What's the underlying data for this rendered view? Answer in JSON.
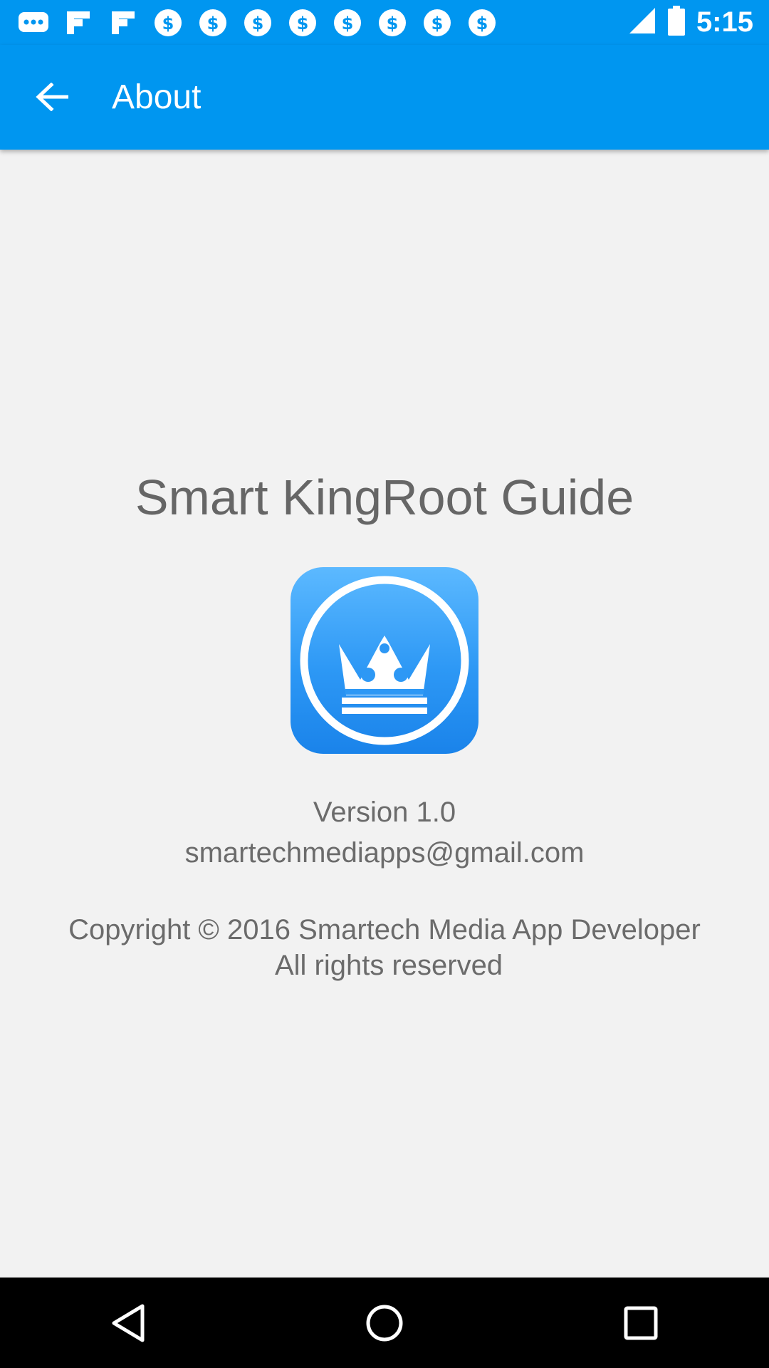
{
  "status_bar": {
    "time": "5:15",
    "icons": [
      "messages-icon",
      "flipboard-icon",
      "flipboard-icon",
      "money-icon",
      "money-icon",
      "money-icon",
      "money-icon",
      "money-icon",
      "money-icon",
      "money-icon",
      "money-icon",
      "signal-icon",
      "battery-icon"
    ]
  },
  "app_bar": {
    "title": "About",
    "color": "#0096f0"
  },
  "about": {
    "app_name": "Smart KingRoot Guide",
    "version": "Version 1.0",
    "email": "smartechmediapps@gmail.com",
    "copyright": "Copyright © 2016 Smartech Media App Developer",
    "rights": "All rights reserved"
  },
  "nav_bar": {
    "buttons": [
      "back-triangle-icon",
      "home-circle-icon",
      "recents-square-icon"
    ]
  }
}
